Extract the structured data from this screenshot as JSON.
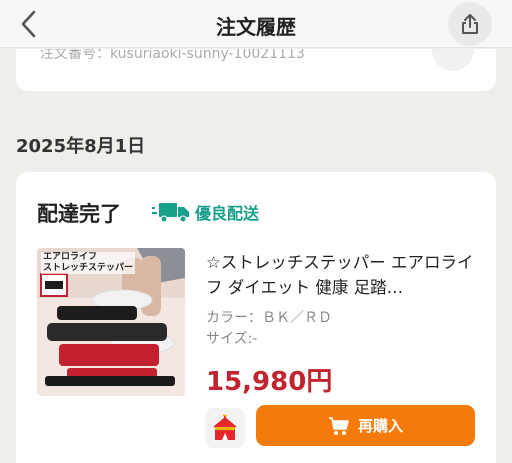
{
  "header": {
    "title": "注文履歴"
  },
  "previous_order": {
    "number_text": "注文番号：kusuriaoki-sunny-10021113"
  },
  "order": {
    "date": "2025年8月1日",
    "status": "配達完了",
    "delivery_badge": "優良配送",
    "product": {
      "image_caption_line1": "エアロライフ",
      "image_caption_line2": "ストレッチステッパー",
      "title": "☆ストレッチステッパー エアロライフ ダイエット 健康 足踏…",
      "color": "カラー：ＢＫ／ＲＤ",
      "size": "サイズ:-",
      "price": "15,980円"
    },
    "rebuy_label": "再購入"
  },
  "colors": {
    "accent_orange": "#f47b0a",
    "price_red": "#c2242f",
    "delivery_green": "#18a08a"
  },
  "icons": [
    "chevron-left-icon",
    "share-icon",
    "delivery-truck-icon",
    "shop-tent-icon",
    "cart-icon"
  ]
}
